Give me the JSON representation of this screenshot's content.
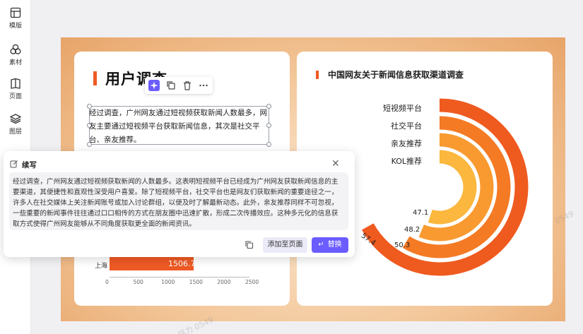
{
  "sidebar": {
    "items": [
      {
        "label": "模版",
        "icon": "template-icon"
      },
      {
        "label": "素材",
        "icon": "assets-icon"
      },
      {
        "label": "页面",
        "icon": "pages-icon"
      },
      {
        "label": "图层",
        "icon": "layers-icon"
      }
    ]
  },
  "watermark": "铭力 0549",
  "left_card": {
    "title": "用户调查",
    "selected_text": "经过调查，广州网友通过短视频获取新闻人数最多，网友主要通过短视频平台获取新闻信息，其次是社交平台、亲友推荐。",
    "bar_chart_data": {
      "type": "bar",
      "visible_category": "上海",
      "visible_value": 1506.7,
      "ticks": [
        "0",
        "500",
        "1000",
        "1500",
        "2000",
        "2500"
      ],
      "xlim": [
        0,
        2500
      ]
    }
  },
  "continue_popup": {
    "title": "续写",
    "body": "经过调查，广州网友通过短视频获取新闻的人数最多。这表明短视频平台已经成为广州网友获取新闻信息的主要渠道，其便捷性和直观性深受用户喜爱。除了短视频平台，社交平台也是网友们获取新闻的重要途径之一，许多人在社交媒体上关注新闻账号或加入讨论群组，以便及时了解最新动态。此外，亲友推荐同样不可忽视，一些重要的新闻事件往往通过口口相传的方式在朋友圈中迅速扩散，形成二次传播效应。这种多元化的信息获取方式使得广州网友能够从不同角度获取更全面的新闻资讯。",
    "add_button": "添加至页面",
    "replace_button": "替换"
  },
  "chart_data": {
    "type": "radial-bar",
    "title": "中国网友关于新闻信息获取渠道调查",
    "categories": [
      "短视频平台",
      "社交平台",
      "亲友推荐",
      "KOL推荐"
    ],
    "values": [
      57.4,
      50.3,
      48.2,
      47.1
    ],
    "value_labels": [
      "57.4",
      "50.3",
      "48.2",
      "47.1"
    ],
    "colors": [
      "#ef5a1f",
      "#f47a24",
      "#f89a30",
      "#fbb73e"
    ]
  },
  "colors": {
    "accent": "#ee5a24",
    "primary_button": "#6b5cff"
  }
}
